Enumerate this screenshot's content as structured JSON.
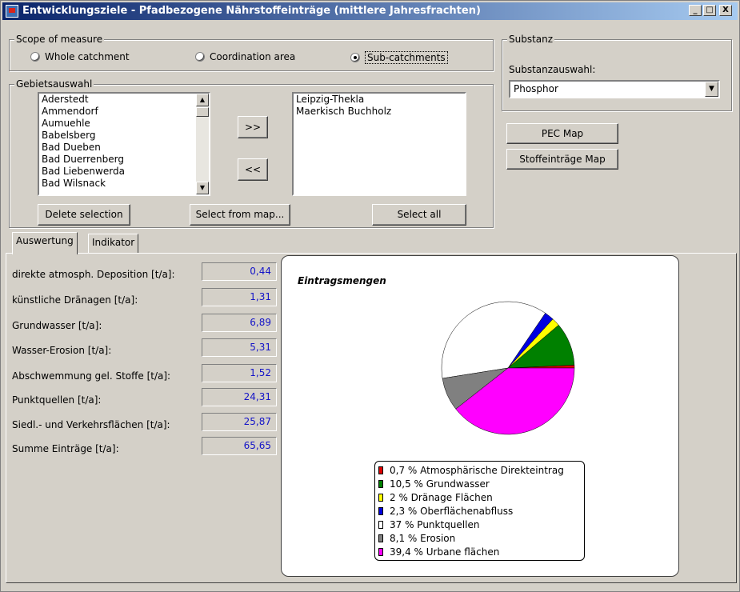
{
  "window": {
    "title": "Entwicklungsziele - Pfadbezogene Nährstoffeinträge (mittlere Jahresfrachten)",
    "minimize": "_",
    "maximize": "□",
    "close": "X"
  },
  "scope": {
    "legend": "Scope of measure",
    "options": [
      {
        "label": "Whole catchment",
        "selected": false
      },
      {
        "label": "Coordination area",
        "selected": false
      },
      {
        "label": "Sub-catchments",
        "selected": true
      }
    ]
  },
  "substanz": {
    "legend": "Substanz",
    "label": "Substanzauswahl:",
    "selected": "Phosphor",
    "pec_button": "PEC Map",
    "stoff_button": "Stoffeinträge Map"
  },
  "gebiet": {
    "legend": "Gebietsauswahl",
    "available": [
      "Aderstedt",
      "Ammendorf",
      "Aumuehle",
      "Babelsberg",
      "Bad Dueben",
      "Bad Duerrenberg",
      "Bad Liebenwerda",
      "Bad Wilsnack"
    ],
    "selected": [
      "Leipzig-Thekla",
      "Maerkisch Buchholz"
    ],
    "add_button": ">>",
    "remove_button": "<<",
    "delete_button": "Delete selection",
    "map_button": "Select from map...",
    "all_button": "Select all"
  },
  "tabs": [
    {
      "label": "Auswertung",
      "active": true
    },
    {
      "label": "Indikator",
      "active": false
    }
  ],
  "results": [
    {
      "label": "direkte atmosph. Deposition [t/a]:",
      "value": "0,44"
    },
    {
      "label": "künstliche Dränagen [t/a]:",
      "value": "1,31"
    },
    {
      "label": "Grundwasser [t/a]:",
      "value": "6,89"
    },
    {
      "label": "Wasser-Erosion [t/a]:",
      "value": "5,31"
    },
    {
      "label": "Abschwemmung gel. Stoffe [t/a]:",
      "value": "1,52"
    },
    {
      "label": "Punktquellen [t/a]:",
      "value": "24,31"
    },
    {
      "label": "Siedl.- und Verkehrsflächen [t/a]:",
      "value": "25,87"
    },
    {
      "label": "Summe Einträge [t/a]:",
      "value": "65,65"
    }
  ],
  "chart_data": {
    "type": "pie",
    "title": "Eintragsmengen",
    "legend_position": "bottom",
    "slices": [
      {
        "label": "0,7 % Atmosphärische Direkteintrag",
        "value": 0.7,
        "color": "#e00000"
      },
      {
        "label": "10,5 % Grundwasser",
        "value": 10.5,
        "color": "#008000"
      },
      {
        "label": "2 % Dränage Flächen",
        "value": 2,
        "color": "#ffff00"
      },
      {
        "label": "2,3 % Oberflächenabfluss",
        "value": 2.3,
        "color": "#0000e0"
      },
      {
        "label": "37 % Punktquellen",
        "value": 37,
        "color": "#ffffff"
      },
      {
        "label": "8,1 % Erosion",
        "value": 8.1,
        "color": "#808080"
      },
      {
        "label": "39,4 % Urbane flächen",
        "value": 39.4,
        "color": "#ff00ff"
      }
    ]
  }
}
